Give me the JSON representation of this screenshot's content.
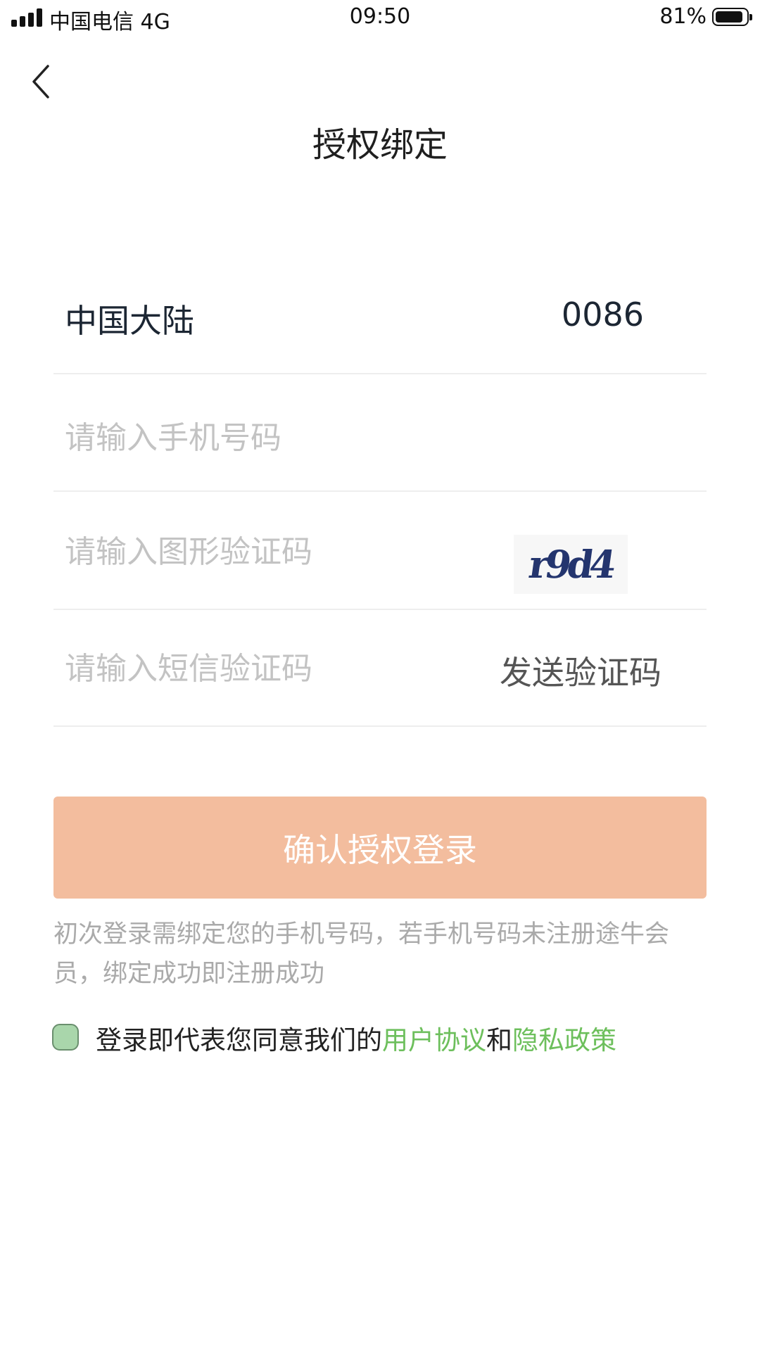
{
  "status_bar": {
    "carrier": "中国电信 4G",
    "time": "09:50",
    "battery": "81%",
    "battery_level": 0.81
  },
  "header": {
    "title": "授权绑定",
    "back_icon": "chevron-left-icon"
  },
  "form": {
    "region_label": "中国大陆",
    "region_code": "0086",
    "phone_placeholder": "请输入手机号码",
    "captcha_placeholder": "请输入图形验证码",
    "captcha_text": "r9d4",
    "sms_placeholder": "请输入短信验证码",
    "send_code_label": "发送验证码"
  },
  "confirm_label": "确认授权登录",
  "notice": "初次登录需绑定您的手机号码，若手机号码未注册途牛会员，绑定成功即注册成功",
  "agreement": {
    "prefix": "登录即代表您同意我们的",
    "user_agreement": "用户协议",
    "and": "和",
    "privacy_policy": "隐私政策"
  },
  "colors": {
    "confirm_button": "#f3bd9e",
    "link": "#6dbf5c",
    "checkbox": "#a9d6ab"
  }
}
